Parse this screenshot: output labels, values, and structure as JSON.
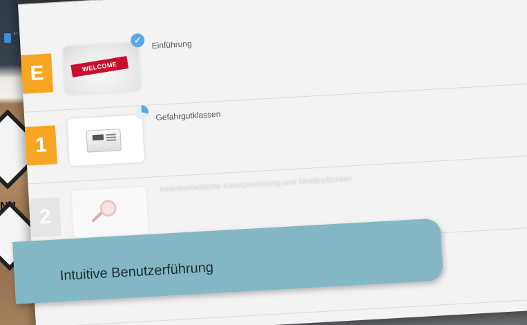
{
  "background": {
    "un_label": "N 1",
    "side_note": "k\nt"
  },
  "course": {
    "items": [
      {
        "badge": "E",
        "title": "Einführung",
        "thumbnail": "WELCOME",
        "status": "completed"
      },
      {
        "badge": "1",
        "title": "Gefahrgutklassen",
        "thumbnail": "device-image",
        "status": "in-progress"
      },
      {
        "badge": "2",
        "title": "Innerbetriebliche Kennzeichnung und Meldepflichten",
        "thumbnail": "magnifier-image",
        "status": "locked"
      }
    ]
  },
  "caption": {
    "text": "Intuitive Benutzerführung"
  },
  "colors": {
    "badge_active": "#f6a623",
    "badge_inactive": "#e6e6e6",
    "status_blue": "#5aa9e6",
    "caption_bg": "#84b7c5"
  }
}
